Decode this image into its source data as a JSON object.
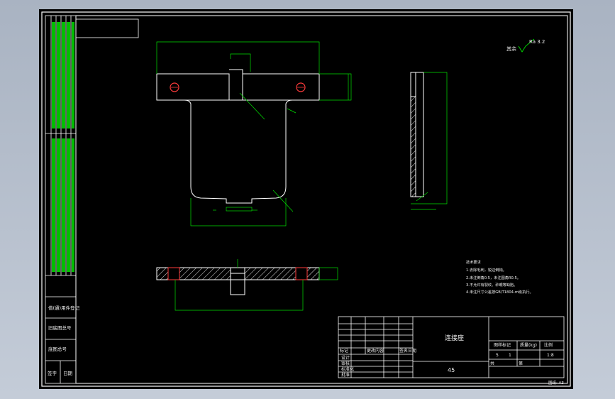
{
  "title_block": {
    "part_name": "连接座",
    "material": "45",
    "scale": "1:8",
    "ref_scale": "1",
    "ref_qty": "5",
    "col_stage": "图样标记",
    "col_weight": "质量(kg)",
    "col_scale": "比例",
    "col_sheets": "共",
    "col_sheet_no": "第",
    "row_mark": "标记",
    "row_zone": "更改内容",
    "row_sign": "签名日期",
    "row_design": "设计",
    "row_check": "审核",
    "row_std": "标准化",
    "row_approve": "批准"
  },
  "roughness": {
    "label": "其余",
    "value": "Ra 3.2"
  },
  "tech_notes": {
    "heading": "技术要求",
    "items": [
      "1.去除毛刺，锐边倒钝。",
      "2.未注倒角0.5，未注圆角R0.5。",
      "3.不允许有裂纹、砂眼等缺陷。",
      "4.未注尺寸公差按GB/T1804-m级执行。"
    ]
  },
  "left_strip": {
    "labels": [
      "借(通)用件登记",
      "旧底图总号",
      "底图总号",
      "签字",
      "日期"
    ]
  },
  "footer_note": "图纸: A3"
}
